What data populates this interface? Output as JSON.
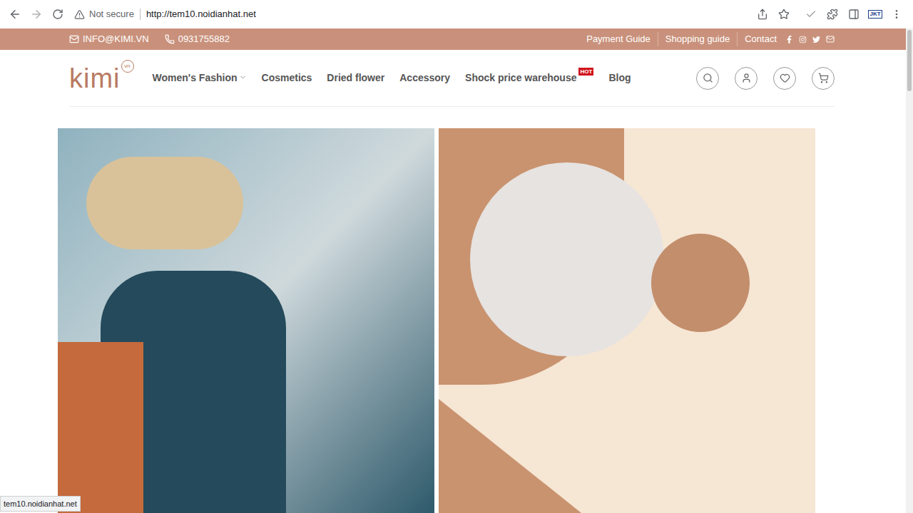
{
  "browser": {
    "security": "Not secure",
    "url": "http://tem10.noidianhat.net",
    "extension_badge": "JKT",
    "status_url": "tem10.noidianhat.net"
  },
  "topbar": {
    "email": "INFO@KIMI.VN",
    "phone": "0931755882",
    "links": [
      "Payment Guide",
      "Shopping guide",
      "Contact"
    ]
  },
  "nav": {
    "logo": {
      "text": "kimi",
      "badge": "vn"
    },
    "menu": [
      {
        "label": "Women's Fashion",
        "dropdown": true,
        "badge": ""
      },
      {
        "label": "Cosmetics",
        "dropdown": false,
        "badge": ""
      },
      {
        "label": "Dried flower",
        "dropdown": false,
        "badge": ""
      },
      {
        "label": "Accessory",
        "dropdown": false,
        "badge": ""
      },
      {
        "label": "Shock price warehouse",
        "dropdown": false,
        "badge": "HOT"
      },
      {
        "label": "Blog",
        "dropdown": false,
        "badge": ""
      }
    ]
  }
}
